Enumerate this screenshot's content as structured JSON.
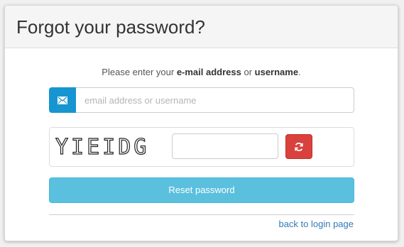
{
  "panel": {
    "title": "Forgot your password?"
  },
  "instructions": {
    "prefix": "Please enter your ",
    "email_term": "e-mail address",
    "middle": " or ",
    "username_term": "username",
    "suffix": "."
  },
  "email_field": {
    "value": "",
    "placeholder": "email address or username",
    "icon": "envelope-icon"
  },
  "captcha": {
    "text": "YIEIDG",
    "input_value": "",
    "refresh_icon": "refresh-icon"
  },
  "buttons": {
    "reset_label": "Reset password"
  },
  "links": {
    "back_label": "back to login page"
  },
  "colors": {
    "addon": "#1795d1",
    "refresh": "#d9413d",
    "reset": "#5bc0de",
    "link": "#337ab7"
  }
}
